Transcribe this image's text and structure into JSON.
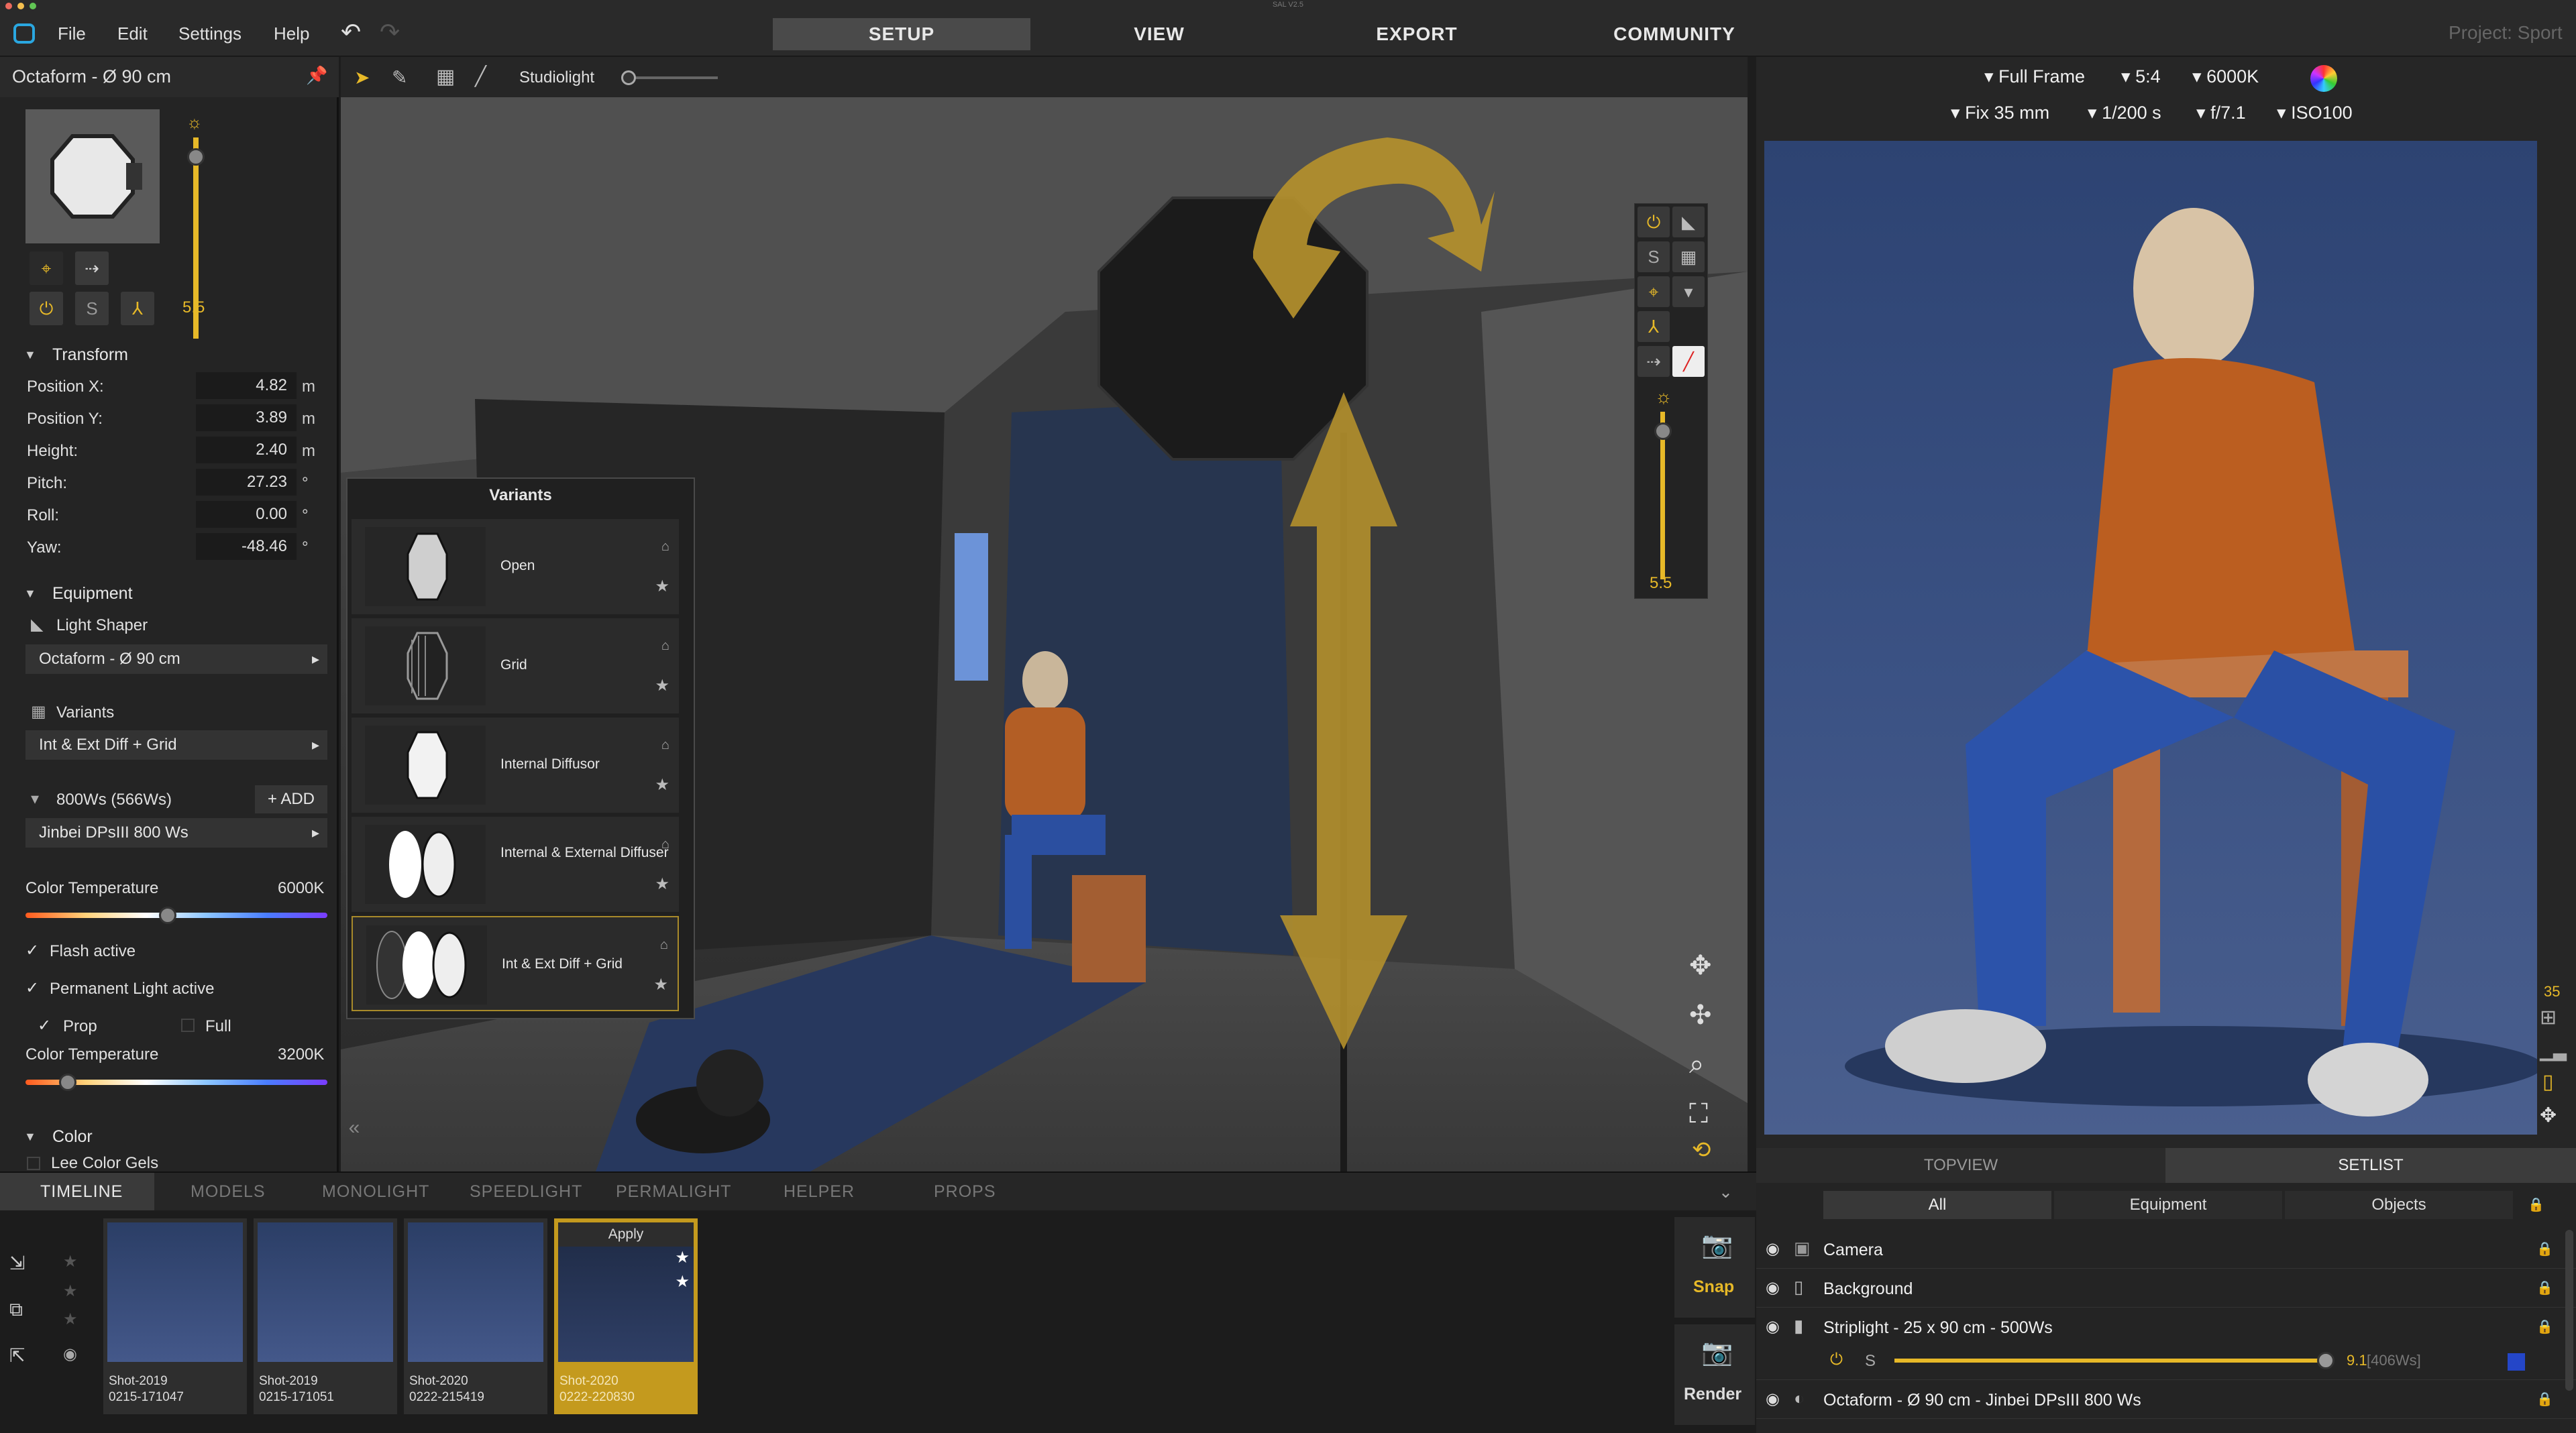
{
  "window": {
    "title": "SAL V2.5"
  },
  "menu": {
    "file": "File",
    "edit": "Edit",
    "settings": "Settings",
    "help": "Help"
  },
  "tabs": {
    "setup": "SETUP",
    "view": "VIEW",
    "export": "EXPORT",
    "community": "COMMUNITY"
  },
  "project": "Project: Sport",
  "left_panel": {
    "title": "Octaform - Ø 90 cm",
    "intensity": "5.5",
    "transform": {
      "header": "Transform",
      "rows": [
        {
          "label": "Position X:",
          "value": "4.82",
          "unit": "m"
        },
        {
          "label": "Position Y:",
          "value": "3.89",
          "unit": "m"
        },
        {
          "label": "Height:",
          "value": "2.40",
          "unit": "m"
        },
        {
          "label": "Pitch:",
          "value": "27.23",
          "unit": "°"
        },
        {
          "label": "Roll:",
          "value": "0.00",
          "unit": "°"
        },
        {
          "label": "Yaw:",
          "value": "-48.46",
          "unit": "°"
        }
      ]
    },
    "equipment": {
      "header": "Equipment",
      "light_shaper_label": "Light Shaper",
      "light_shaper_value": "Octaform - Ø 90 cm",
      "variants_label": "Variants",
      "variants_value": "Int & Ext Diff + Grid",
      "power_label": "800Ws (566Ws)",
      "add_label": "ADD",
      "head_value": "Jinbei DPsIII 800 Ws"
    },
    "color_temp_label": "Color Temperature",
    "color_temp_value": "6000K",
    "flash_active": "Flash active",
    "permanent_active": "Permanent Light active",
    "prop_label": "Prop",
    "full_label": "Full",
    "color_temp2_label": "Color Temperature",
    "color_temp2_value": "3200K",
    "color": {
      "header": "Color",
      "gels": "Lee Color Gels"
    }
  },
  "viewport": {
    "tool_label": "Studiolight",
    "intensity": "5.5"
  },
  "variants_popup": {
    "title": "Variants",
    "items": [
      "Open",
      "Grid",
      "Internal Diffusor",
      "Internal & External Diffuser",
      "Int & Ext Diff + Grid"
    ]
  },
  "camera": {
    "sensor": "Full Frame",
    "ratio": "5:4",
    "wb": "6000K",
    "lens": "Fix 35 mm",
    "shutter": "1/200 s",
    "aperture": "f/7.1",
    "iso": "ISO100",
    "focal_readout": "35"
  },
  "bottom_tabs": {
    "timeline": "TIMELINE",
    "models": "MODELS",
    "monolight": "MONOLIGHT",
    "speedlight": "SPEEDLIGHT",
    "permalight": "PERMALIGHT",
    "helper": "HELPER",
    "props": "PROPS"
  },
  "shots": [
    {
      "name": "Shot-2019",
      "id": "0215-171047"
    },
    {
      "name": "Shot-2019",
      "id": "0215-171051"
    },
    {
      "name": "Shot-2020",
      "id": "0222-215419"
    },
    {
      "name": "Shot-2020",
      "id": "0222-220830"
    }
  ],
  "apply_label": "Apply",
  "snap_label": "Snap",
  "render_label": "Render",
  "setlist": {
    "topview": "TOPVIEW",
    "setlist": "SETLIST",
    "filters": [
      "All",
      "Equipment",
      "Objects"
    ],
    "rows": [
      "Camera",
      "Background",
      "Striplight - 25 x 90 cm - 500Ws",
      "Octaform - Ø 90 cm - Jinbei DPsIII 800 Ws"
    ],
    "strip_power": "9.1",
    "strip_ws": "[406Ws]",
    "strip_s": "S"
  },
  "colors": {
    "accent": "#e7b928",
    "panel": "#242424"
  }
}
